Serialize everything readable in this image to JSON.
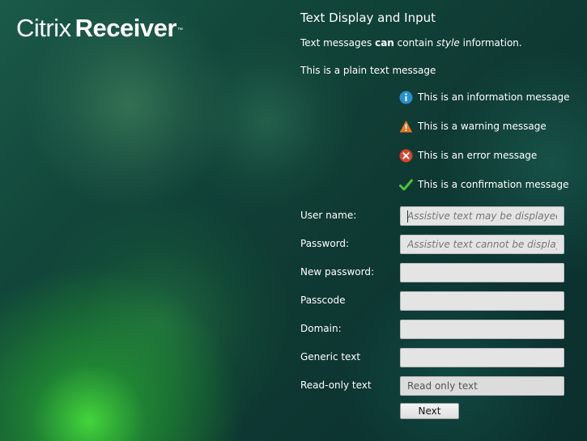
{
  "brand": {
    "word1": "Citrix",
    "word2": "Receiver",
    "trademark": "™"
  },
  "page": {
    "title": "Text Display and Input",
    "rich_text": {
      "part1": "Text messages ",
      "bold": "can",
      "part2": " contain ",
      "italic": "style",
      "part3": " information."
    },
    "plain_text": "This is a plain text message"
  },
  "messages": {
    "info": {
      "text": "This is an information message",
      "icon": "info-icon",
      "color": "#2a8fd0"
    },
    "warning": {
      "text": "This is a warning message",
      "icon": "warning-icon",
      "color": "#e87722"
    },
    "error": {
      "text": "This is an error message",
      "icon": "error-icon",
      "color": "#d9432a"
    },
    "confirm": {
      "text": "This is a confirmation message",
      "icon": "check-icon",
      "color": "#4ec23b"
    }
  },
  "form": {
    "username": {
      "label": "User name:",
      "value": "",
      "placeholder": "Assistive text may be displayed inline"
    },
    "password": {
      "label": "Password:",
      "value": "",
      "placeholder": "Assistive text cannot be displayed i..."
    },
    "new_password": {
      "label": "New password:",
      "value": "",
      "placeholder": ""
    },
    "passcode": {
      "label": "Passcode",
      "value": "",
      "placeholder": ""
    },
    "domain": {
      "label": "Domain:",
      "value": "",
      "placeholder": ""
    },
    "generic": {
      "label": "Generic text",
      "value": "",
      "placeholder": ""
    },
    "readonly": {
      "label": "Read-only text",
      "value": "Read only text"
    },
    "next_label": "Next"
  }
}
